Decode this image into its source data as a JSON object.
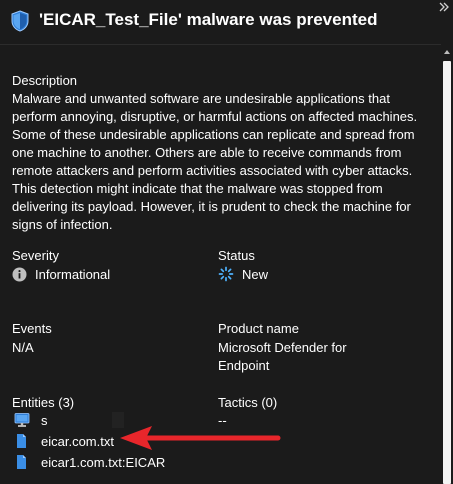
{
  "header": {
    "title": "'EICAR_Test_File' malware was prevented",
    "icon": "shield-icon",
    "collapse_icon": "double-chevron-right-icon"
  },
  "description": {
    "label": "Description",
    "text": "Malware and unwanted software are undesirable applications that perform annoying, disruptive, or harmful actions on affected machines. Some of these undesirable applications can replicate and spread from one machine to another. Others are able to receive commands from remote attackers and perform activities associated with cyber attacks. This detection might indicate that the malware was stopped from delivering its payload. However, it is prudent to check the machine for signs of infection."
  },
  "severity": {
    "label": "Severity",
    "value": "Informational",
    "icon": "info-icon"
  },
  "status": {
    "label": "Status",
    "value": "New",
    "icon": "spinner-icon",
    "icon_color": "#4fb3ff"
  },
  "events": {
    "label": "Events",
    "value": "N/A"
  },
  "product": {
    "label": "Product name",
    "value": "Microsoft Defender for Endpoint"
  },
  "entities": {
    "label": "Entities (3)",
    "items": [
      {
        "label": "s",
        "icon": "machine-icon"
      },
      {
        "label": "eicar.com.txt",
        "icon": "file-icon"
      },
      {
        "label": "eicar1.com.txt:EICAR",
        "icon": "file-icon"
      }
    ]
  },
  "tactics": {
    "label": "Tactics (0)",
    "value": "--"
  },
  "colors": {
    "background": "#1b1b1b",
    "text": "#ffffff",
    "accent_blue": "#4fb3ff",
    "annotation_arrow": "#e8262b"
  }
}
